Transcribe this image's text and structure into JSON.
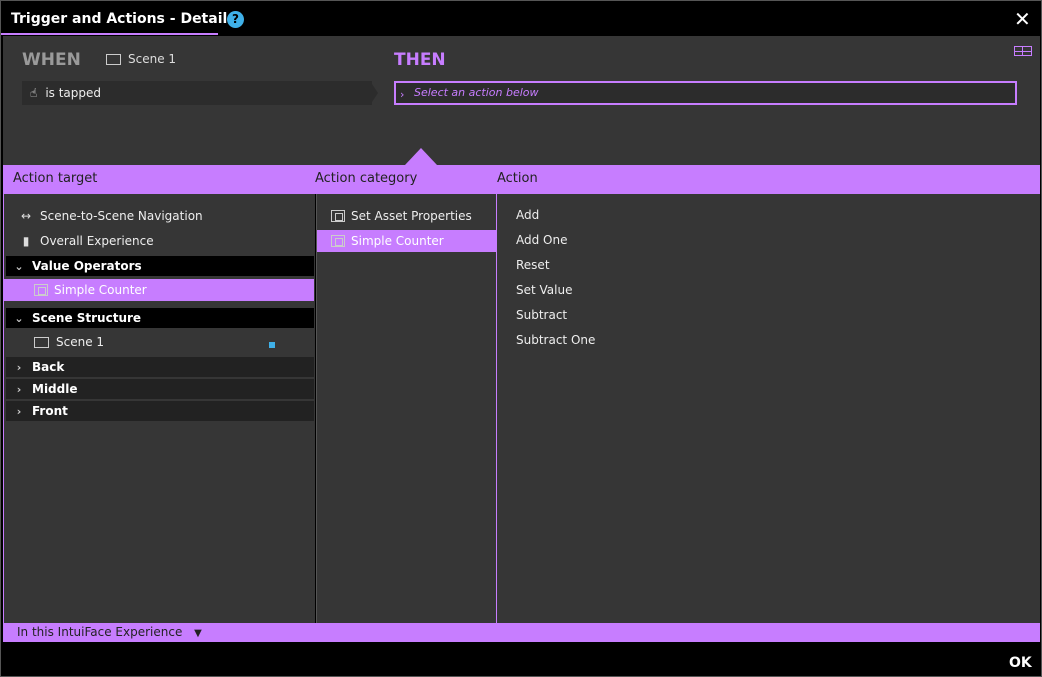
{
  "window": {
    "title": "Trigger and Actions - Details",
    "help": "?",
    "close": "✕"
  },
  "when": {
    "label": "WHEN",
    "scene": "Scene 1",
    "trigger": "is tapped"
  },
  "then": {
    "label": "THEN",
    "placeholder": "Select an action below"
  },
  "headers": {
    "target": "Action target",
    "category": "Action category",
    "action": "Action"
  },
  "targets": {
    "nav": "Scene-to-Scene Navigation",
    "overall": "Overall Experience",
    "value_operators": "Value Operators",
    "simple_counter": "Simple Counter",
    "scene_structure": "Scene Structure",
    "scene1": "Scene 1",
    "back": "Back",
    "middle": "Middle",
    "front": "Front"
  },
  "categories": [
    "Set Asset Properties",
    "Simple Counter"
  ],
  "actions": [
    "Add",
    "Add One",
    "Reset",
    "Set Value",
    "Subtract",
    "Subtract One"
  ],
  "footer": {
    "scope": "In this IntuiFace Experience"
  },
  "ok": "OK",
  "colors": {
    "accent": "#c77dff",
    "panel": "#363636",
    "info": "#3fb0e8"
  }
}
